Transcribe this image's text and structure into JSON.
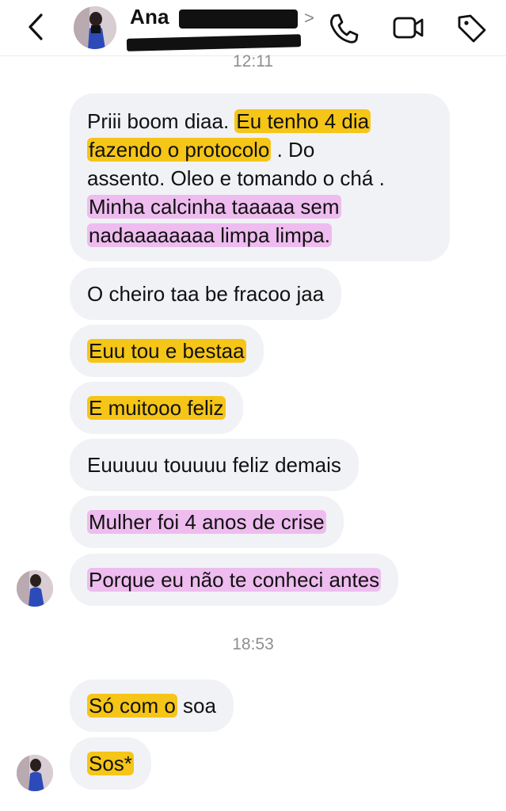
{
  "header": {
    "contact_name": "Ana",
    "username_redacted": true,
    "icons": [
      "back-chevron-icon",
      "phone-icon",
      "video-camera-icon",
      "tag-icon"
    ]
  },
  "timestamps": [
    "12:11",
    "18:53"
  ],
  "messages": [
    {
      "lines": [
        [
          "Priii boom diaa. ",
          "Eu tenho 4 dia"
        ],
        [
          "fazendo o protocolo",
          " . Do"
        ],
        [
          "assento.  Oleo e tomando o chá ."
        ],
        [
          "Minha calcinha taaaaa sem"
        ],
        [
          "nadaaaaaaaa limpa limpa."
        ]
      ]
    },
    {
      "text": "O cheiro taa be fracoo jaa"
    },
    {
      "text": "Euu tou e bestaa"
    },
    {
      "text": "E muitooo feliz"
    },
    {
      "text": "Euuuuu touuuu feliz demais"
    },
    {
      "text": "Mulher foi 4 anos de crise"
    },
    {
      "text": "Porque eu não te conheci antes"
    },
    {
      "parts": [
        "Só com o",
        " soa"
      ]
    },
    {
      "text": "Sos*"
    }
  ],
  "colors": {
    "bubble": "#f1f2f6",
    "highlight_yellow": "#f5c518",
    "highlight_pink": "#eebcef",
    "timestamp": "#8e8e93"
  }
}
